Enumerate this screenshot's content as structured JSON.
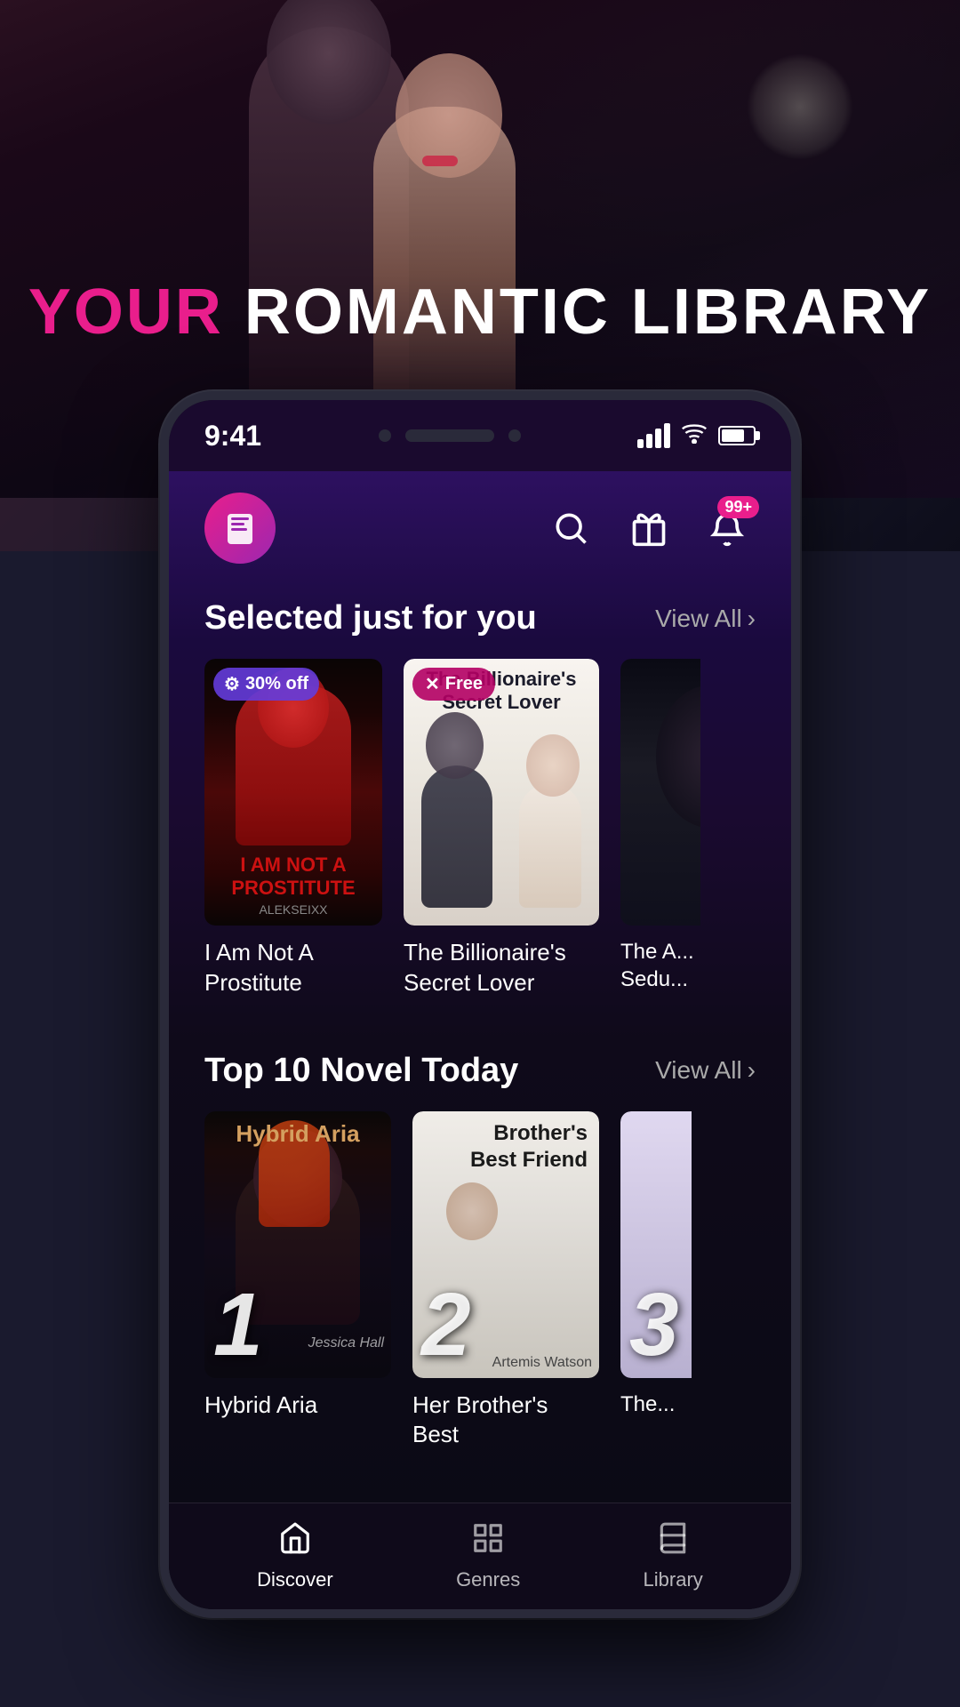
{
  "hero": {
    "title_your": "YOUR",
    "title_rest": " ROMANTIC LIBRARY"
  },
  "status_bar": {
    "time": "9:41",
    "notification_badge": "99+"
  },
  "header": {
    "search_label": "search",
    "gift_label": "gift",
    "bell_label": "bell"
  },
  "section_for_you": {
    "title": "Selected just for you",
    "view_all": "View All"
  },
  "books_for_you": [
    {
      "badge_type": "discount",
      "badge_text": "30% off",
      "title": "I Am Not A Prostitute",
      "author": "ALEKSEIXX",
      "cover_type": "prostitute"
    },
    {
      "badge_type": "free",
      "badge_text": "Free",
      "title": "The Billionaire's Secret Lover",
      "author": "",
      "cover_type": "billionaire"
    },
    {
      "badge_type": "none",
      "badge_text": "",
      "title": "The A... Sedu...",
      "author": "",
      "cover_type": "third"
    }
  ],
  "section_top10": {
    "title": "Top 10 Novel Today",
    "view_all": "View All"
  },
  "books_top10": [
    {
      "rank": "1",
      "title": "Hybrid Aria",
      "author": "Jessica Hall",
      "cover_type": "hybrid"
    },
    {
      "rank": "2",
      "title": "Her Brother's Best",
      "author": "Artemis Watson",
      "cover_type": "brother"
    },
    {
      "rank": "3",
      "title": "The...",
      "author": "",
      "cover_type": "third_top"
    }
  ],
  "bottom_nav": [
    {
      "label": "Discover",
      "icon": "home",
      "active": true
    },
    {
      "label": "Genres",
      "icon": "grid",
      "active": false
    },
    {
      "label": "Library",
      "icon": "book",
      "active": false
    }
  ]
}
